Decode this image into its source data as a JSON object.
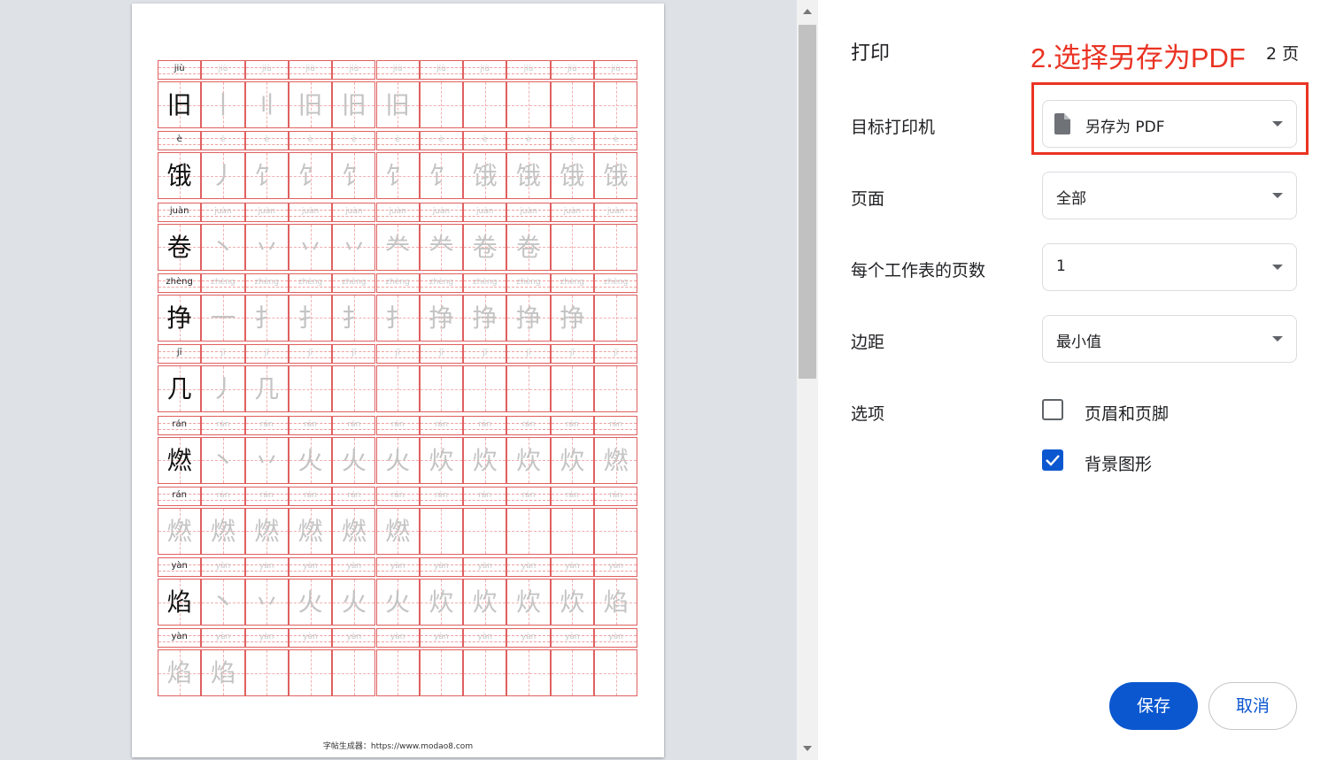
{
  "preview": {
    "rows": [
      {
        "pinyin": "jiù",
        "chars": [
          "旧",
          "丨",
          "〢",
          "旧",
          "旧",
          "旧",
          "",
          "",
          "",
          "",
          ""
        ]
      },
      {
        "pinyin": "è",
        "chars": [
          "饿",
          "丿",
          "饣",
          "饣",
          "饣",
          "饣",
          "饣",
          "饿",
          "饿",
          "饿",
          "饿"
        ]
      },
      {
        "pinyin": "juàn",
        "chars": [
          "卷",
          "丶",
          "丷",
          "丷",
          "丷",
          "龹",
          "龹",
          "卷",
          "卷",
          "",
          ""
        ]
      },
      {
        "pinyin": "zhèng",
        "chars": [
          "挣",
          "一",
          "扌",
          "扌",
          "扌",
          "扌",
          "挣",
          "挣",
          "挣",
          "挣",
          ""
        ]
      },
      {
        "pinyin": "jī",
        "chars": [
          "几",
          "丿",
          "几",
          "",
          "",
          "",
          "",
          "",
          "",
          "",
          ""
        ]
      },
      {
        "pinyin": "rán",
        "chars": [
          "燃",
          "丶",
          "丷",
          "火",
          "火",
          "火",
          "炊",
          "炊",
          "炊",
          "炊",
          "燃"
        ]
      },
      {
        "pinyin": "rán",
        "chars": [
          "燃",
          "燃",
          "燃",
          "燃",
          "燃",
          "燃",
          "",
          "",
          "",
          "",
          ""
        ]
      },
      {
        "pinyin": "yàn",
        "chars": [
          "焰",
          "丶",
          "丷",
          "火",
          "火",
          "火",
          "炊",
          "炊",
          "炊",
          "炊",
          "焰"
        ]
      },
      {
        "pinyin": "yàn",
        "chars": [
          "焰",
          "焰",
          "",
          "",
          "",
          "",
          "",
          "",
          "",
          "",
          ""
        ]
      }
    ],
    "ghost_rows": [
      0,
      1,
      2,
      3,
      4,
      5,
      6,
      7,
      8
    ],
    "trace_first": [
      6,
      8
    ],
    "footer": "字帖生成器：https://www.modao8.com"
  },
  "panel": {
    "title": "打印",
    "annotation": "2.选择另存为PDF",
    "page_count": "2 页",
    "destination_label": "目标打印机",
    "destination_value": "另存为 PDF",
    "pages_label": "页面",
    "pages_value": "全部",
    "per_sheet_label": "每个工作表的页数",
    "per_sheet_value": "1",
    "margins_label": "边距",
    "margins_value": "最小值",
    "options_label": "选项",
    "option_headers": "页眉和页脚",
    "option_background": "背景图形",
    "option_headers_checked": false,
    "option_background_checked": true,
    "save_label": "保存",
    "cancel_label": "取消"
  },
  "colors": {
    "accent": "#0b57d0",
    "annotation": "#ea3323",
    "grid_line": "#e06060"
  }
}
